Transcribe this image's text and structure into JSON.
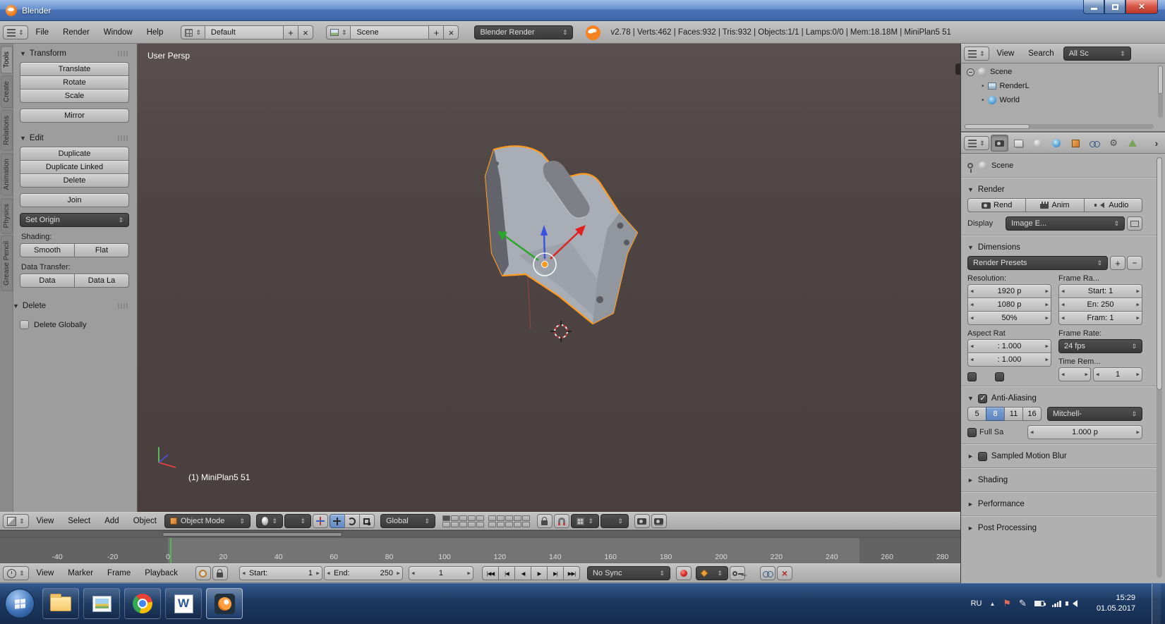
{
  "glyphs": {
    "expanded": "▼",
    "collapsed": "►"
  },
  "titlebar": {
    "title": "Blender"
  },
  "infobar": {
    "menus": [
      "File",
      "Render",
      "Window",
      "Help"
    ],
    "layout": "Default",
    "scene": "Scene",
    "engine": "Blender Render",
    "stats": "v2.78 | Verts:462 | Faces:932 | Tris:932 | Objects:1/1 | Lamps:0/0 | Mem:18.18M | MiniPlan5 51"
  },
  "toolshelf": {
    "tabs": [
      "Tools",
      "Create",
      "Relations",
      "Animation",
      "Physics",
      "Grease Pencil"
    ],
    "transform": {
      "title": "Transform",
      "buttons": [
        "Translate",
        "Rotate",
        "Scale"
      ],
      "mirror": "Mirror"
    },
    "edit": {
      "title": "Edit",
      "buttons": [
        "Duplicate",
        "Duplicate Linked",
        "Delete"
      ],
      "join": "Join",
      "set_origin": "Set Origin",
      "shading_label": "Shading:",
      "smooth": "Smooth",
      "flat": "Flat",
      "data_label": "Data Transfer:",
      "data": "Data",
      "data_la": "Data La"
    },
    "delete": {
      "title": "Delete",
      "item": "Delete Globally"
    }
  },
  "viewport": {
    "view_label": "User Persp",
    "object_label": "(1) MiniPlan5 51",
    "header": {
      "menus": [
        "View",
        "Select",
        "Add",
        "Object"
      ],
      "mode": "Object Mode",
      "orientation": "Global"
    }
  },
  "timeline": {
    "frames": [
      -40,
      -20,
      0,
      20,
      40,
      60,
      80,
      100,
      120,
      140,
      160,
      180,
      200,
      220,
      240,
      260,
      280
    ],
    "header": {
      "menus": [
        "View",
        "Marker",
        "Frame",
        "Playback"
      ],
      "start_label": "Start:",
      "start_value": "1",
      "end_label": "End:",
      "end_value": "250",
      "current_frame": "1",
      "sync": "No Sync"
    }
  },
  "outliner": {
    "menus": [
      "View",
      "Search"
    ],
    "display_mode": "All Sc",
    "items": [
      "Scene",
      "RenderL",
      "World"
    ]
  },
  "properties": {
    "context": "Scene",
    "render": {
      "title": "Render",
      "render_button": "Rend",
      "anim_button": "Anim",
      "audio_button": "Audio",
      "display_label": "Display",
      "display_value": "Image E..."
    },
    "dimensions": {
      "title": "Dimensions",
      "presets": "Render Presets",
      "resolution_label": "Resolution:",
      "frame_range_label": "Frame Ra...",
      "res_x": "1920 p",
      "res_y": "1080 p",
      "res_pct": "50%",
      "frame_start": "Start: 1",
      "frame_end": "En: 250",
      "frame_step": "Fram: 1",
      "aspect_label": "Aspect Rat",
      "frame_rate_label": "Frame Rate:",
      "aspect_x": ": 1.000",
      "aspect_y": ": 1.000",
      "fps": "24 fps",
      "time_remap_label": "Time Rem...",
      "time_remap_value": "1"
    },
    "antialiasing": {
      "title": "Anti-Aliasing",
      "samples": [
        "5",
        "8",
        "11",
        "16"
      ],
      "active_sample": "8",
      "filter": "Mitchell-",
      "full_sample_label": "Full Sa",
      "pixel_size": "1.000 p"
    },
    "collapsed_panels": [
      "Sampled Motion Blur",
      "Shading",
      "Performance",
      "Post Processing"
    ]
  },
  "taskbar": {
    "language": "RU",
    "time": "15:29",
    "date": "01.05.2017"
  }
}
